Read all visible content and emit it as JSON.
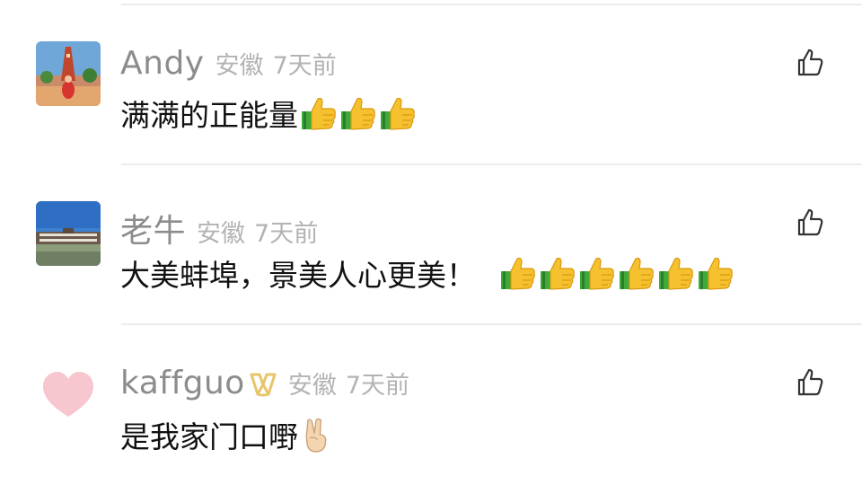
{
  "comments": [
    {
      "username": "Andy",
      "location": "安徽",
      "time": "7天前",
      "text": "满满的正能量",
      "emoji": "thumbs-up",
      "emoji_count": 3
    },
    {
      "username": "老牛",
      "location": "安徽",
      "time": "7天前",
      "text": "大美蚌埠，景美人心更美！",
      "emoji": "thumbs-up",
      "emoji_count": 6
    },
    {
      "username": "kaffguo",
      "location": "安徽",
      "time": "7天前",
      "text": "是我家门口嘢",
      "emoji": "victory-hand",
      "emoji_count": 1
    }
  ],
  "colors": {
    "username": "#8c8c8c",
    "meta": "#b3b3b3",
    "text": "#111111",
    "badge": "#e8c46a",
    "thumb_yellow": "#f6c12f",
    "cuff_green": "#3faa3a"
  }
}
